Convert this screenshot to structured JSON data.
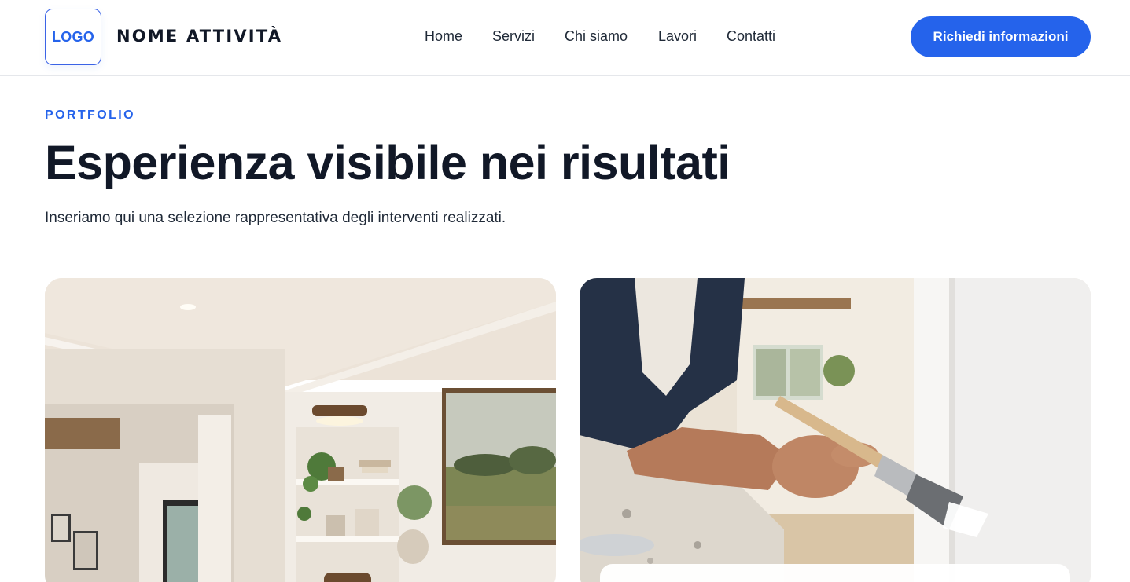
{
  "header": {
    "logo_label": "LOGO",
    "brand_name": "NOME ATTIVITÀ",
    "nav": [
      {
        "label": "Home"
      },
      {
        "label": "Servizi"
      },
      {
        "label": "Chi siamo"
      },
      {
        "label": "Lavori"
      },
      {
        "label": "Contatti"
      }
    ],
    "cta_label": "Richiedi informazioni"
  },
  "section": {
    "eyebrow": "PORTFOLIO",
    "title": "Esperienza visibile nei risultati",
    "subtitle": "Inseriamo qui una selezione rappresentativa degli interventi realizzati."
  },
  "colors": {
    "accent": "#2563eb",
    "text": "#111827",
    "border": "#e5e7eb"
  },
  "cards": [
    {
      "image": "living-room-interior-photo"
    },
    {
      "image": "painter-with-brush-photo"
    }
  ]
}
